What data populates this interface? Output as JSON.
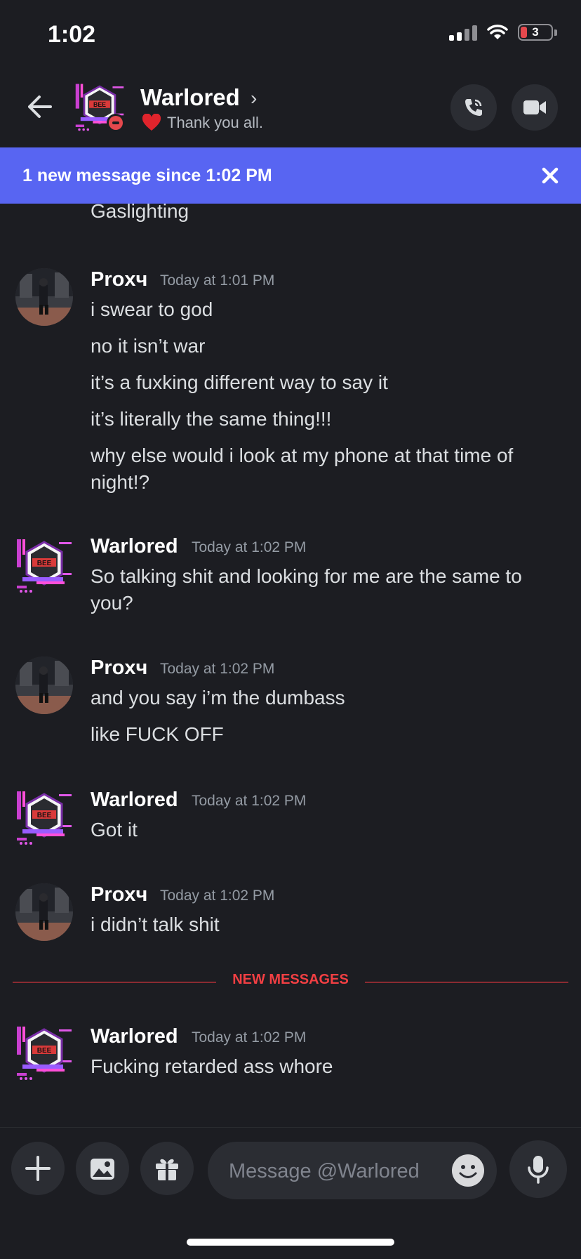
{
  "status_bar": {
    "time": "1:02",
    "battery": "3",
    "icons": [
      "cellular-signal-icon",
      "wifi-icon",
      "battery-icon"
    ]
  },
  "header": {
    "name": "Warlored",
    "status_text": "Thank you all.",
    "status_emoji": "heart-icon",
    "icons": [
      "back-arrow-icon",
      "chevron-right-icon",
      "call-icon",
      "video-icon"
    ]
  },
  "banner": {
    "text": "1 new message since 1:02 PM",
    "close_icon": "close-icon"
  },
  "messages": {
    "partial_line": "Gaslighting",
    "groups": [
      {
        "author": "Proxч",
        "time": "Today at 1:01 PM",
        "lines": [
          "i swear to god",
          "no it isn’t war",
          "it’s a fuxking different way to say it",
          "it’s literally the same thing!!!",
          "why else would i look at my phone at that time of",
          "night!?"
        ]
      },
      {
        "author": "Warlored",
        "time": "Today at 1:02 PM",
        "lines": [
          "So talking shit and looking for me are the same to",
          "you?"
        ]
      },
      {
        "author": "Proxч",
        "time": "Today at 1:02 PM",
        "lines": [
          "and you say i’m the dumbass",
          "like FUCK OFF"
        ]
      },
      {
        "author": "Warlored",
        "time": "Today at 1:02 PM",
        "lines": [
          "Got it"
        ]
      },
      {
        "author": "Proxч",
        "time": "Today at 1:02 PM",
        "lines": [
          "i didn’t talk shit"
        ]
      },
      {
        "author": "Warlored",
        "time": "Today at 1:02 PM",
        "lines": [
          "Fucking retarded ass whore"
        ]
      }
    ],
    "new_messages_label": "NEW MESSAGES"
  },
  "composer": {
    "placeholder": "Message @Warlored",
    "icons": [
      "plus-icon",
      "image-icon",
      "gift-icon",
      "emoji-icon",
      "microphone-icon"
    ]
  },
  "colors": {
    "background": "#1c1d22",
    "banner": "#5865f2",
    "new_messages": "#f23f43",
    "panel": "#2b2d33"
  }
}
